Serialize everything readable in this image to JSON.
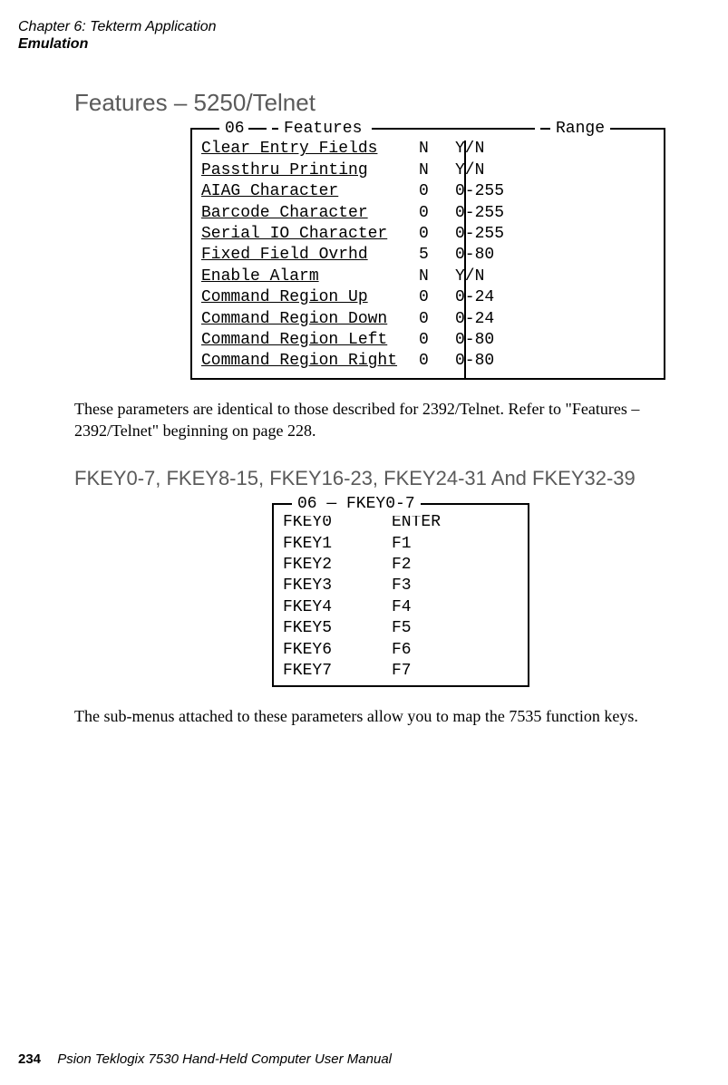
{
  "header": {
    "chapter": "Chapter 6: Tekterm Application",
    "section": "Emulation"
  },
  "title_5250": "Features – 5250/Telnet",
  "features_box": {
    "leg_prefix": "06",
    "leg_title": "Features",
    "leg_range": "Range",
    "rows": [
      {
        "label": "Clear Entry Fields",
        "value": "N",
        "range": "Y/N"
      },
      {
        "label": "Passthru Printing",
        "value": "N",
        "range": "Y/N"
      },
      {
        "label": "AIAG Character",
        "value": "0",
        "range": "0-255"
      },
      {
        "label": "Barcode Character",
        "value": "0",
        "range": "0-255"
      },
      {
        "label": "Serial IO Character",
        "value": "0",
        "range": "0-255"
      },
      {
        "label": "Fixed Field Ovrhd",
        "value": "5",
        "range": "0-80"
      },
      {
        "label": "Enable Alarm",
        "value": "N",
        "range": "Y/N"
      },
      {
        "label": "Command Region Up",
        "value": "0",
        "range": "0-24"
      },
      {
        "label": "Command Region Down",
        "value": "0",
        "range": "0-24"
      },
      {
        "label": "Command Region Left",
        "value": "0",
        "range": "0-80"
      },
      {
        "label": "Command Region Right",
        "value": "0",
        "range": "0-80"
      }
    ]
  },
  "para1": "These parameters are identical to those described for 2392/Telnet. Refer to \"Features – 2392/Telnet\" beginning on page 228.",
  "fkey_heading": "FKEY0-7, FKEY8-15, FKEY16-23, FKEY24-31 And FKEY32-39",
  "fkey_box": {
    "legend": "06 — FKEY0-7",
    "rows": [
      {
        "key": "FKEY0",
        "map": "ENTER"
      },
      {
        "key": "FKEY1",
        "map": "F1"
      },
      {
        "key": "FKEY2",
        "map": "F2"
      },
      {
        "key": "FKEY3",
        "map": "F3"
      },
      {
        "key": "FKEY4",
        "map": "F4"
      },
      {
        "key": "FKEY5",
        "map": "F5"
      },
      {
        "key": "FKEY6",
        "map": "F6"
      },
      {
        "key": "FKEY7",
        "map": "F7"
      }
    ]
  },
  "para2": "The sub-menus attached to these parameters allow you to map the 7535 function keys.",
  "footer": {
    "page": "234",
    "manual": "Psion Teklogix 7530 Hand-Held Computer User Manual"
  }
}
